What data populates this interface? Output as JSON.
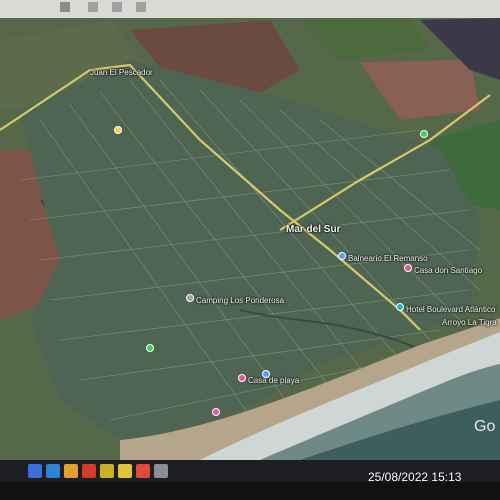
{
  "map": {
    "places": [
      {
        "name": "Juan El Pescador",
        "color": "#9aa0a6"
      },
      {
        "name": "Mar del Sur",
        "color": "#ffffff"
      },
      {
        "name": "Balneario El Remanso",
        "color": "#4aa3ff"
      },
      {
        "name": "Casa don Santiago",
        "color": "#e0569a"
      },
      {
        "name": "Hotel Boulevard Atlántico",
        "color": "#27b3c9"
      },
      {
        "name": "Arroyo La Tigra",
        "color": "#9aa0a6"
      },
      {
        "name": "Camping Los Ponderosa",
        "color": "#9aa0a6"
      },
      {
        "name": "Casa de playa",
        "color": "#e0569a"
      }
    ],
    "watermark": "Go"
  },
  "photo": {
    "timestamp": "25/08/2022 15:13"
  }
}
